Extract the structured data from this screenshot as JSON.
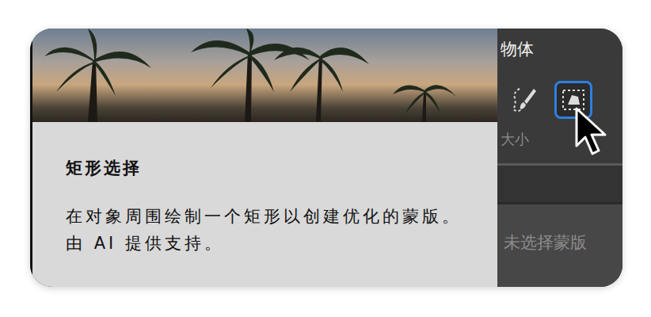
{
  "tooltip": {
    "title": "矩形选择",
    "description": "在对象周围绘制一个矩形以创建优化的蒙版。由 AI 提供支持。"
  },
  "panel": {
    "title": "物体",
    "tools": [
      {
        "kind": "lasso-brush",
        "selected": false
      },
      {
        "kind": "rectangle",
        "selected": true
      }
    ],
    "size_label": "大小",
    "mask_status": {
      "label": "未选择蒙版",
      "disabled": true
    }
  }
}
